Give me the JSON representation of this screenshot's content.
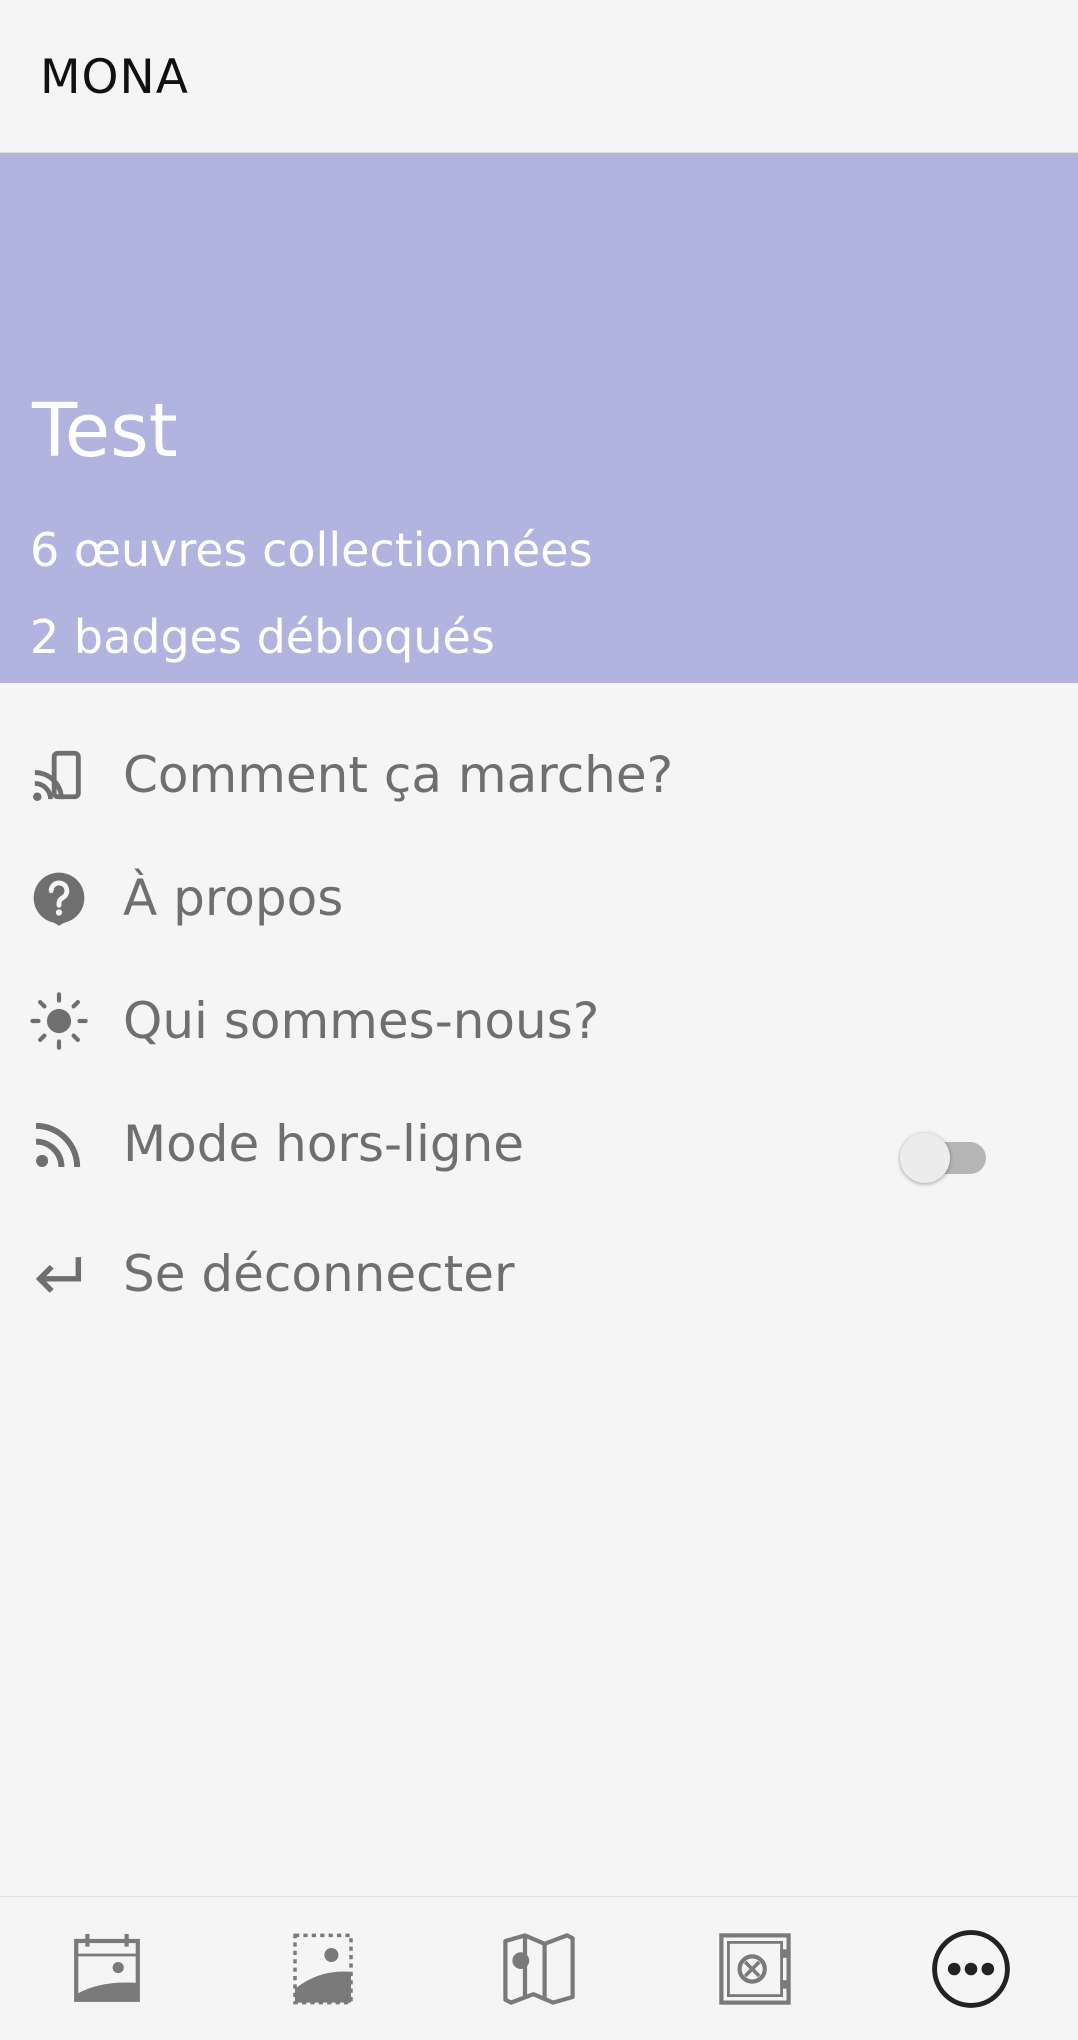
{
  "app_bar": {
    "title": "MONA"
  },
  "profile": {
    "name": "Test",
    "works_collected": "6 œuvres collectionnées",
    "badges_unlocked": "2 badges débloqués",
    "header_color": "#b1b4de"
  },
  "menu": {
    "items": [
      {
        "label": "Comment ça marche?",
        "icon": "cast-phone-icon"
      },
      {
        "label": "À propos",
        "icon": "help-bubble-icon"
      },
      {
        "label": "Qui sommes-nous?",
        "icon": "sun-icon"
      },
      {
        "label": "Mode hors-ligne",
        "icon": "rss-feed-icon",
        "toggle": false
      },
      {
        "label": "Se déconnecter",
        "icon": "logout-arrow-icon"
      }
    ]
  },
  "bottom_nav": {
    "items": [
      {
        "icon": "daily-artwork-icon",
        "active": false
      },
      {
        "icon": "collection-gallery-icon",
        "active": false
      },
      {
        "icon": "map-icon",
        "active": false
      },
      {
        "icon": "vault-icon",
        "active": false
      },
      {
        "icon": "more-icon",
        "active": true
      }
    ]
  }
}
